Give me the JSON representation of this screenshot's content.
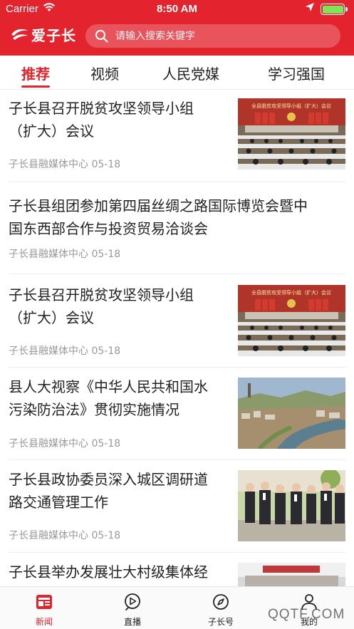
{
  "status_bar": {
    "carrier": "Carrier",
    "time": "8:50 AM",
    "battery_level": 1.0
  },
  "header": {
    "logo_text": "爱子长",
    "search_placeholder": "请输入搜索关键字"
  },
  "tabs": [
    {
      "label": "推荐",
      "active": true
    },
    {
      "label": "视频",
      "active": false
    },
    {
      "label": "人民党媒",
      "active": false
    },
    {
      "label": "学习强国",
      "active": false
    }
  ],
  "news": [
    {
      "title_lines": [
        "子长县召开脱贫攻坚领导小组",
        "（扩大）会议"
      ],
      "source": "子长县融媒体中心",
      "date": "05-18",
      "image_caption": "全县脱贫攻坚领导小组（扩大）会议",
      "has_image": true
    },
    {
      "title_lines": [
        "子长县组团参加第四届丝绸之路国际博览会暨中",
        "国东西部合作与投资贸易洽谈会"
      ],
      "source": "子长县融媒体中心",
      "date": "05-18",
      "has_image": false
    },
    {
      "title_lines": [
        "子长县召开脱贫攻坚领导小组",
        "（扩大）会议"
      ],
      "source": "子长县融媒体中心",
      "date": "05-18",
      "image_caption": "全县脱贫攻坚领导小组（扩大）会议",
      "has_image": true
    },
    {
      "title_lines": [
        "县人大视察《中华人民共和国水",
        "污染防治法》贯彻实施情况"
      ],
      "source": "子长县融媒体中心",
      "date": "05-18",
      "has_image": true
    },
    {
      "title_lines": [
        "子长县政协委员深入城区调研道",
        "路交通管理工作"
      ],
      "source": "子长县融媒体中心",
      "date": "05-18",
      "has_image": true
    },
    {
      "title_lines": [
        "子长县举办发展壮大村级集体经"
      ],
      "has_image": true
    }
  ],
  "bottom_nav": [
    {
      "label": "新闻",
      "icon": "news-icon",
      "active": true
    },
    {
      "label": "直播",
      "icon": "play-icon",
      "active": false
    },
    {
      "label": "子长号",
      "icon": "compass-icon",
      "active": false
    },
    {
      "label": "我的",
      "icon": "person-icon",
      "active": false
    }
  ],
  "watermark": "QQTF.COM",
  "colors": {
    "brand_red": "#e3232d",
    "meta_gray": "#999999"
  }
}
